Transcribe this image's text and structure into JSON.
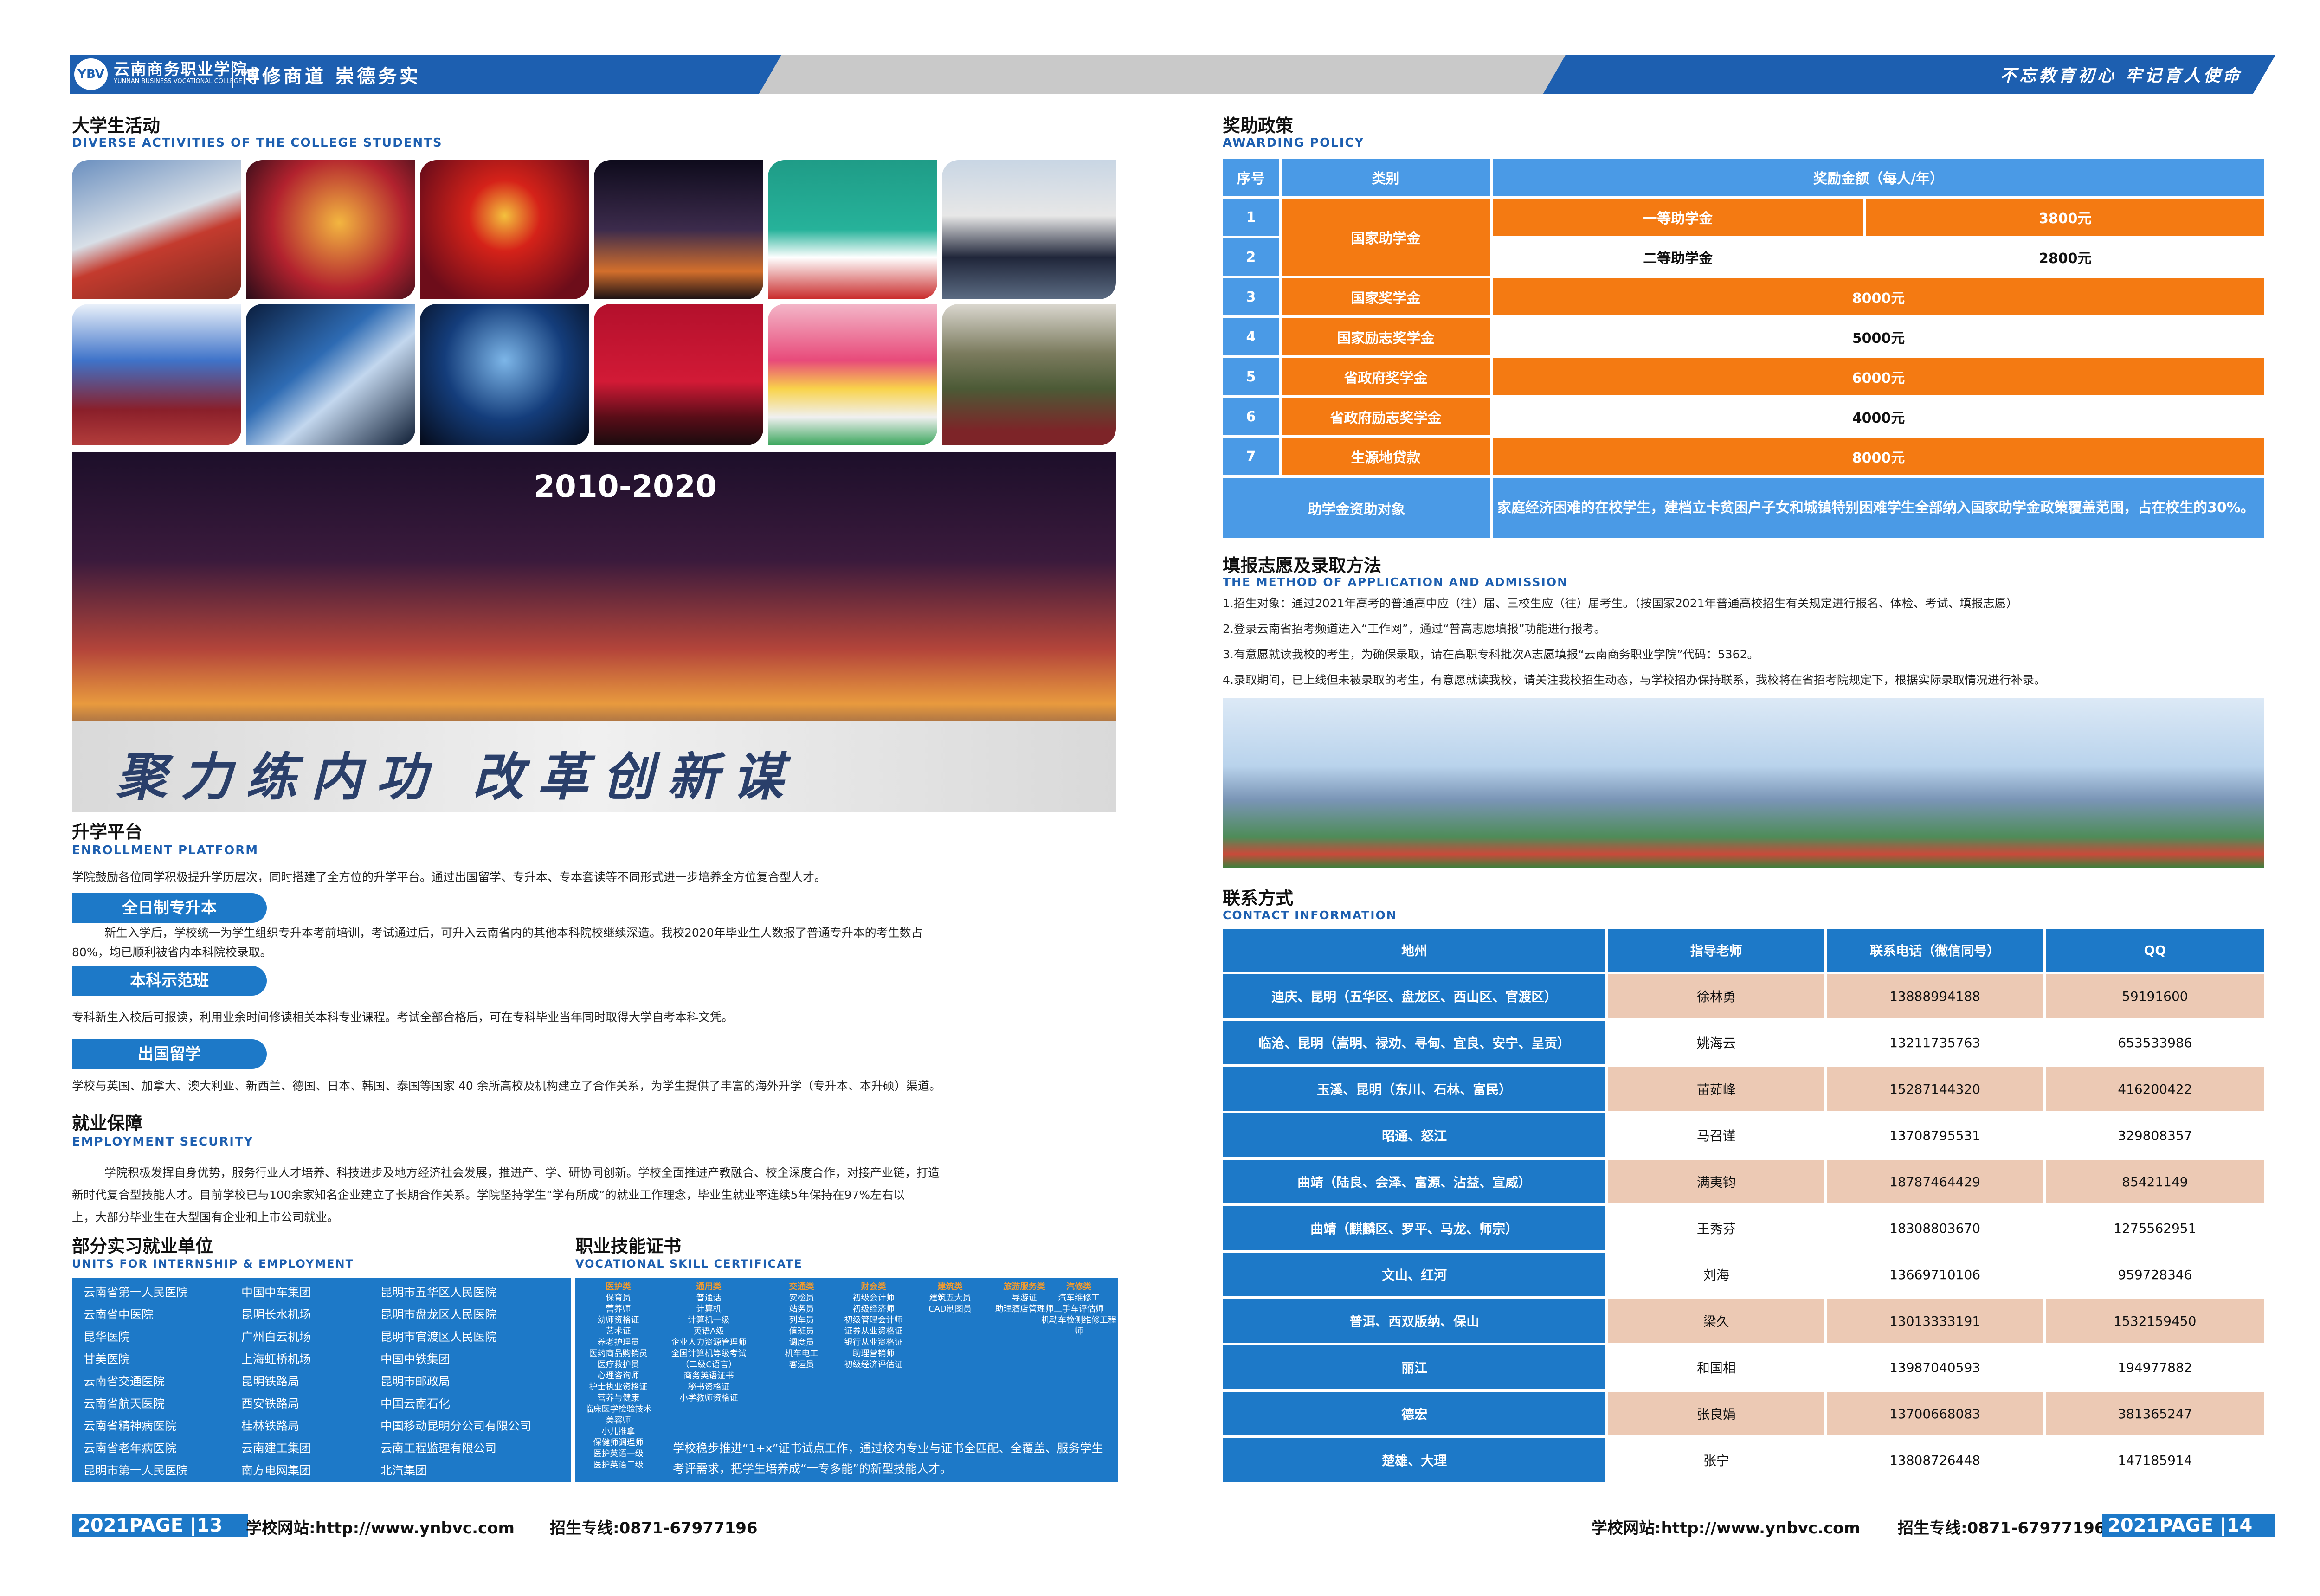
{
  "header": {
    "school_name": "云南商务职业学院",
    "school_name_en": "YUNNAN BUSINESS VOCATIONAL COLLEGE",
    "motto": "博修商道 崇德务实",
    "slogan": "不忘教育初心 牢记育人使命",
    "logo_text": "YBV"
  },
  "activities": {
    "title_cn": "大学生活动",
    "title_en": "DIVERSE ACTIVITIES OF THE COLLEGE STUDENTS",
    "stage_year": "2010-2020",
    "banner_text": "聚力练内功  改革创新谋"
  },
  "enrollment": {
    "title_cn": "升学平台",
    "title_en": "ENROLLMENT PLATFORM",
    "intro": "学院鼓励各位同学积极提升学历层次，同时搭建了全方位的升学平台。通过出国留学、专升本、专本套读等不同形式进一步培养全方位复合型人才。",
    "p1_label": "全日制专升本",
    "p1_text_1": "新生入学后，学校统一为学生组织专升本考前培训，考试通过后，可升入云南省内的其他本科院校继续深造。我校2020年毕业生人数报了普通专升本的考生数占",
    "p1_text_2": "80%，均已顺利被省内本科院校录取。",
    "p2_label": "本科示范班",
    "p2_text": "专科新生入校后可报读，利用业余时间修读相关本科专业课程。考试全部合格后，可在专科毕业当年同时取得大学自考本科文凭。",
    "p3_label": "出国留学",
    "p3_text": "学校与英国、加拿大、澳大利亚、新西兰、德国、日本、韩国、泰国等国家 40 余所高校及机构建立了合作关系，为学生提供了丰富的海外升学（专升本、本升硕）渠道。"
  },
  "employment": {
    "title_cn": "就业保障",
    "title_en": "EMPLOYMENT SECURITY",
    "line1": "学院积极发挥自身优势，服务行业人才培养、科技进步及地方经济社会发展，推进产、学、研协同创新。学校全面推进产教融合、校企深度合作，对接产业链，打造",
    "line2": "新时代复合型技能人才。目前学校已与100余家知名企业建立了长期合作关系。学院坚持学生“学有所成”的就业工作理念，毕业生就业率连续5年保持在97%左右以",
    "line3": "上，大部分毕业生在大型国有企业和上市公司就业。"
  },
  "units": {
    "title_cn": "部分实习就业单位",
    "title_en": "UNITS FOR INTERNSHIP & EMPLOYMENT",
    "col1": [
      "云南省第一人民医院",
      "云南省中医院",
      "昆华医院",
      "甘美医院",
      "云南省交通医院",
      "云南省航天医院",
      "云南省精神病医院",
      "云南省老年病医院",
      "昆明市第一人民医院"
    ],
    "col2": [
      "中国中车集团",
      "昆明长水机场",
      "广州白云机场",
      "上海虹桥机场",
      "昆明铁路局",
      "西安铁路局",
      "桂林铁路局",
      "云南建工集团",
      "南方电网集团"
    ],
    "col3": [
      "昆明市五华区人民医院",
      "昆明市盘龙区人民医院",
      "昆明市官渡区人民医院",
      "中国中铁集团",
      "昆明市邮政局",
      "中国云南石化",
      "中国移动昆明分公司有限公司",
      "云南工程监理有限公司",
      "北汽集团"
    ]
  },
  "certs": {
    "title_cn": "职业技能证书",
    "title_en": "VOCATIONAL SKILL CERTIFICATE",
    "cols": [
      {
        "head": "医护类",
        "items": [
          "保育员",
          "营养师",
          "幼师资格证",
          "艺术证",
          "养老护理员",
          "医药商品购销员",
          "医疗救护员",
          "心理咨询师",
          "护士执业资格证",
          "营养与健康",
          "临床医学检验技术",
          "美容师",
          "小儿推拿",
          "保健师调理师",
          "医护英语一级",
          "医护英语二级"
        ]
      },
      {
        "head": "通用类",
        "items": [
          "普通话",
          "计算机",
          "计算机一级",
          "英语A级",
          "企业人力资源管理师",
          "全国计算机等级考试",
          "（二级C语言）",
          "商务英语证书",
          "秘书资格证",
          "小学教师资格证"
        ]
      },
      {
        "head": "交通类",
        "items": [
          "安检员",
          "站务员",
          "列车员",
          "值班员",
          "调度员",
          "机车电工",
          "客运员"
        ]
      },
      {
        "head": "财会类",
        "items": [
          "初级会计师",
          "初级经济师",
          "初级管理会计师",
          "证券从业资格证",
          "银行从业资格证",
          "助理营销师",
          "初级经济评估证"
        ]
      },
      {
        "head": "建筑类",
        "items": [
          "建筑五大员",
          "CAD制图员"
        ]
      },
      {
        "head": "旅游服务类",
        "items": [
          "导游证",
          "助理酒店管理师"
        ]
      },
      {
        "head": "汽修类",
        "items": [
          "汽车维修工",
          "二手车评估师",
          "机动车检测维修工程师"
        ]
      }
    ],
    "note": "学校稳步推进“1+x”证书试点工作，通过校内专业与证书全匹配、全覆盖、服务学生考评需求，把学生培养成“一专多能”的新型技能人才。"
  },
  "award": {
    "title_cn": "奖助政策",
    "title_en": "AWARDING POLICY",
    "headers": [
      "序号",
      "类别",
      "奖励金额（每人/年）"
    ],
    "rows": [
      {
        "no": "1",
        "name": "国家助学金",
        "sub": "一等助学金",
        "amount": "3800元"
      },
      {
        "no": "2",
        "name": "国家助学金",
        "sub": "二等助学金",
        "amount": "2800元"
      },
      {
        "no": "3",
        "name": "国家奖学金",
        "amount": "8000元"
      },
      {
        "no": "4",
        "name": "国家励志奖学金",
        "amount": "5000元"
      },
      {
        "no": "5",
        "name": "省政府奖学金",
        "amount": "6000元"
      },
      {
        "no": "6",
        "name": "省政府励志奖学金",
        "amount": "4000元"
      },
      {
        "no": "7",
        "name": "生源地贷款",
        "amount": "8000元"
      }
    ],
    "target_label": "助学金资助对象",
    "target_text": "家庭经济困难的在校学生，建档立卡贫困户子女和城镇特别困难学生全部纳入国家助学金政策覆盖范围，占在校生的30%。"
  },
  "application": {
    "title_cn": "填报志愿及录取方法",
    "title_en": "THE METHOD OF APPLICATION AND ADMISSION",
    "items": [
      "1.招生对象：通过2021年高考的普通高中应（往）届、三校生应（往）届考生。（按国家2021年普通高校招生有关规定进行报名、体检、考试、填报志愿）",
      "2.登录云南省招考频道进入“工作网”，通过“普高志愿填报”功能进行报考。",
      "3.有意愿就读我校的考生，为确保录取，请在高职专科批次A志愿填报“云南商务职业学院”代码：5362。",
      "4.录取期间，已上线但未被录取的考生，有意愿就读我校，请关注我校招生动态，与学校招办保持联系，我校将在省招考院规定下，根据实际录取情况进行补录。"
    ]
  },
  "contact": {
    "title_cn": "联系方式",
    "title_en": "CONTACT  INFORMATION",
    "headers": [
      "地州",
      "指导老师",
      "联系电话（微信同号）",
      "QQ"
    ],
    "rows": [
      [
        "迪庆、昆明（五华区、盘龙区、西山区、官渡区）",
        "徐林勇",
        "13888994188",
        "59191600"
      ],
      [
        "临沧、昆明（嵩明、禄劝、寻甸、宜良、安宁、呈贡）",
        "姚海云",
        "13211735763",
        "653533986"
      ],
      [
        "玉溪、昆明（东川、石林、富民）",
        "苗茹峰",
        "15287144320",
        "416200422"
      ],
      [
        "昭通、怒江",
        "马召谨",
        "13708795531",
        "329808357"
      ],
      [
        "曲靖（陆良、会泽、富源、沾益、宣威）",
        "满夷钧",
        "18787464429",
        "85421149"
      ],
      [
        "曲靖（麒麟区、罗平、马龙、师宗）",
        "王秀芬",
        "18308803670",
        "1275562951"
      ],
      [
        "文山、红河",
        "刘海",
        "13669710106",
        "959728346"
      ],
      [
        "普洱、西双版纳、保山",
        "梁久",
        "13013333191",
        "1532159450"
      ],
      [
        "丽江",
        "和国相",
        "13987040593",
        "194977882"
      ],
      [
        "德宏",
        "张良娟",
        "13700668083",
        "381365247"
      ],
      [
        "楚雄、大理",
        "张宁",
        "13808726448",
        "147185914"
      ]
    ]
  },
  "footer": {
    "left_page": "2021PAGE  |13",
    "right_page": "2021PAGE  |14",
    "website": "学校网站:http://www.ynbvc.com",
    "hotline": "招生专线:0871-67977196"
  }
}
